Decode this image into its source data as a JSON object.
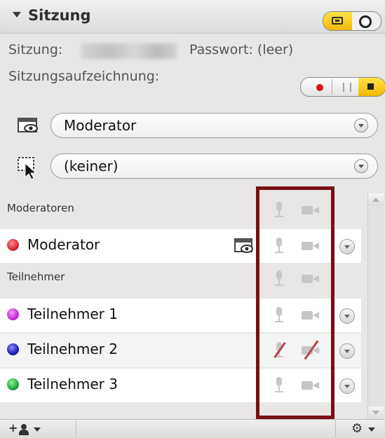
{
  "panel": {
    "title": "Sitzung",
    "session_label": "Sitzung:",
    "password_text": "Passwort: (leer)",
    "recording_label": "Sitzungsaufzeichnung:"
  },
  "presenter_select": {
    "value": "Moderator",
    "icon": "presenter-screen-icon"
  },
  "control_select": {
    "value": "(keiner)",
    "icon": "remote-control-icon"
  },
  "groups": [
    {
      "label": "Moderatoren"
    },
    {
      "label": "Teilnehmer"
    }
  ],
  "moderators": [
    {
      "name": "Moderator",
      "color": "#d42a35",
      "mic": "enabled",
      "camera": "enabled"
    }
  ],
  "participants": [
    {
      "name": "Teilnehmer 1",
      "color": "#c42ad8",
      "mic": "enabled",
      "camera": "enabled"
    },
    {
      "name": "Teilnehmer 2",
      "color": "#1c1cb8",
      "mic": "disabled",
      "camera": "disabled"
    },
    {
      "name": "Teilnehmer 3",
      "color": "#22a83a",
      "mic": "enabled",
      "camera": "enabled"
    }
  ],
  "colors": {
    "highlight_border": "#7a0f16",
    "toggle_active": "#f2b900",
    "record_dot": "#d11111"
  },
  "footer": {
    "add_icon": "add-person-icon",
    "options_icon": "gear-icon"
  }
}
